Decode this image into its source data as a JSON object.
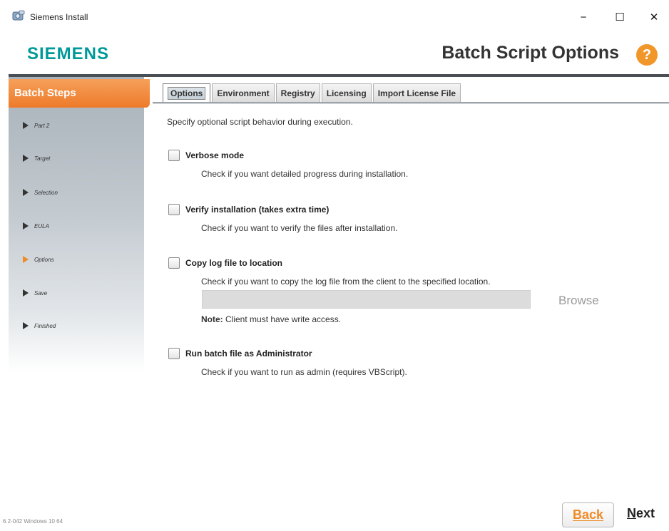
{
  "window": {
    "title": "Siemens Install",
    "controls": {
      "minimize": "−",
      "maximize": "☐",
      "close": "✕"
    }
  },
  "header": {
    "logo": "SIEMENS",
    "page_title": "Batch Script Options",
    "help_icon": "?"
  },
  "sidebar": {
    "header": "Batch Steps",
    "steps": [
      {
        "label": "Part 2",
        "active": false
      },
      {
        "label": "Target",
        "active": false
      },
      {
        "label": "Selection",
        "active": false
      },
      {
        "label": "EULA",
        "active": false
      },
      {
        "label": "Options",
        "active": true
      },
      {
        "label": "Save",
        "active": false
      },
      {
        "label": "Finished",
        "active": false
      }
    ],
    "version": "6.2-042  Windows 10 64"
  },
  "tabs": [
    {
      "label": "Options",
      "active": true
    },
    {
      "label": "Environment",
      "active": false
    },
    {
      "label": "Registry",
      "active": false
    },
    {
      "label": "Licensing",
      "active": false
    },
    {
      "label": "Import License File",
      "active": false
    }
  ],
  "content": {
    "description": "Specify optional script behavior during execution.",
    "options": [
      {
        "label": "Verbose mode",
        "help": "Check if you want detailed progress during installation.",
        "checked": false
      },
      {
        "label": "Verify installation (takes extra time)",
        "help": "Check if you want to verify the files after installation.",
        "checked": false
      },
      {
        "label": "Copy log file to location",
        "help": "Check if you want to copy the log file from the client to the specified location.",
        "checked": false
      },
      {
        "label": "Run batch file as Administrator",
        "help": "Check if you want to run as admin (requires VBScript).",
        "checked": false
      }
    ],
    "location_value": "",
    "browse_label": "Browse",
    "note_bold": "Note:",
    "note_text": " Client must have write access."
  },
  "footer": {
    "back_label": "Back",
    "next_label_underlined": "N",
    "next_label_rest": "ext"
  },
  "colors": {
    "brand_teal": "#009999",
    "accent_orange": "#f08a24",
    "header_bar": "#4a4f55"
  },
  "icons": {
    "app": "siemens-install-icon",
    "help": "help-icon",
    "step_arrow": "play-arrow-icon"
  }
}
